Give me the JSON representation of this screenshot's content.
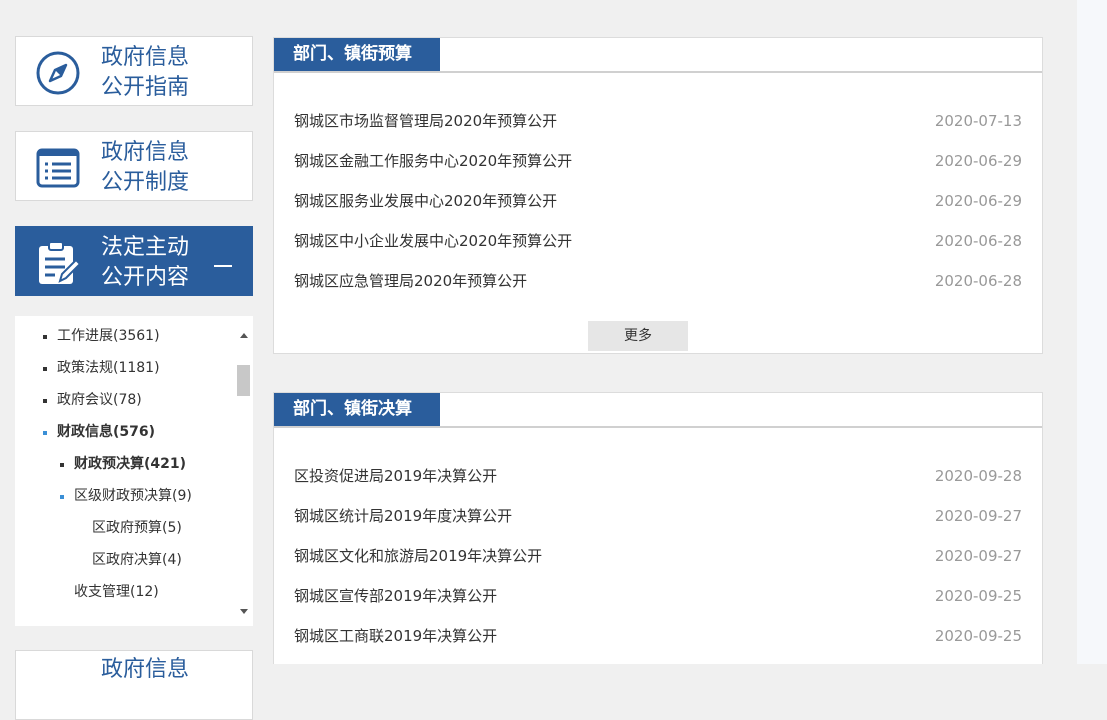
{
  "sidebar": {
    "cards": [
      {
        "label_1": "政府信息",
        "label_2": "公开指南"
      },
      {
        "label_1": "政府信息",
        "label_2": "公开制度"
      },
      {
        "label_1": "法定主动",
        "label_2": "公开内容"
      }
    ],
    "partial_card_label": "政府信息",
    "tree": [
      {
        "label": "工作进展(3561)"
      },
      {
        "label": "政策法规(1181)"
      },
      {
        "label": "政府会议(78)"
      },
      {
        "label": "财政信息(576)"
      },
      {
        "label": "财政预决算(421)"
      },
      {
        "label": "区级财政预决算(9)"
      },
      {
        "label": "区政府预算(5)"
      },
      {
        "label": "区政府决算(4)"
      },
      {
        "label": "收支管理(12)"
      }
    ]
  },
  "budget_panel": {
    "title": "部门、镇街预算",
    "items": [
      {
        "title": "钢城区市场监督管理局2020年预算公开",
        "date": "2020-07-13"
      },
      {
        "title": "钢城区金融工作服务中心2020年预算公开",
        "date": "2020-06-29"
      },
      {
        "title": "钢城区服务业发展中心2020年预算公开",
        "date": "2020-06-29"
      },
      {
        "title": "钢城区中小企业发展中心2020年预算公开",
        "date": "2020-06-28"
      },
      {
        "title": "钢城区应急管理局2020年预算公开",
        "date": "2020-06-28"
      }
    ],
    "more_label": "更多"
  },
  "final_panel": {
    "title": "部门、镇街决算",
    "items": [
      {
        "title": "区投资促进局2019年决算公开",
        "date": "2020-09-28"
      },
      {
        "title": "钢城区统计局2019年度决算公开",
        "date": "2020-09-27"
      },
      {
        "title": "钢城区文化和旅游局2019年决算公开",
        "date": "2020-09-27"
      },
      {
        "title": "钢城区宣传部2019年决算公开",
        "date": "2020-09-25"
      },
      {
        "title": "钢城区工商联2019年决算公开",
        "date": "2020-09-25"
      }
    ]
  },
  "colors": {
    "accent": "#2a5d9c",
    "tree_bullet_active": "#3a8fd6",
    "date_text": "#999999"
  },
  "icons": [
    "compass-icon",
    "list-document-icon",
    "clipboard-edit-icon",
    "minus-icon",
    "scroll-up-icon",
    "scroll-down-icon"
  ]
}
